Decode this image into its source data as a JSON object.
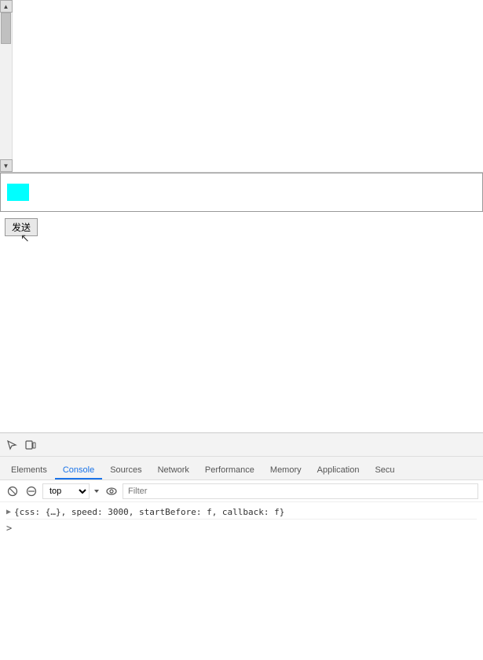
{
  "top_panel": {
    "scroll_up_arrow": "▲",
    "scroll_down_arrow": "▼"
  },
  "input_area": {
    "placeholder": ""
  },
  "send_button": {
    "label": "发送"
  },
  "devtools": {
    "tabs": [
      {
        "label": "Elements",
        "active": false
      },
      {
        "label": "Console",
        "active": true
      },
      {
        "label": "Sources",
        "active": false
      },
      {
        "label": "Network",
        "active": false
      },
      {
        "label": "Performance",
        "active": false
      },
      {
        "label": "Memory",
        "active": false
      },
      {
        "label": "Application",
        "active": false
      },
      {
        "label": "Secu",
        "active": false
      }
    ],
    "console": {
      "context": "top",
      "filter_placeholder": "Filter",
      "log_entry": "{css: {…}, speed: 3000, startBefore: f, callback: f}"
    }
  }
}
